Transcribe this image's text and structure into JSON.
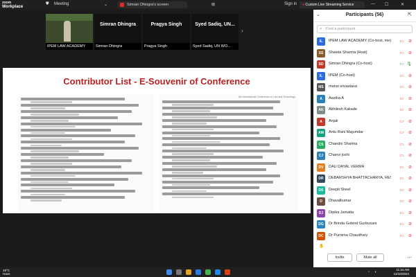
{
  "app": {
    "logo_line1": "zoom",
    "logo_line2": "Workplace",
    "meeting_label": "Meeting",
    "screen_tab_label": "Simran Dhingra's screen",
    "sign_in": "Sign in",
    "streaming_label": "Custom Live Streaming Service"
  },
  "video_tiles": [
    {
      "name": "IPEM LAW ACADEMY",
      "big_name": ""
    },
    {
      "name": "Simran Dhingra",
      "big_name": "Simran Dhingra"
    },
    {
      "name": "Pragya Singh",
      "big_name": "Pragya Singh"
    },
    {
      "name": "Syed Sadiq, UN WO...",
      "big_name": "Syed Sadiq, UN..."
    }
  ],
  "slide": {
    "title": "Contributor List - E-Souvenir of Conference",
    "right_header": "6th International Conference on Law and Technology"
  },
  "participants": {
    "title": "Participants (56)",
    "search_placeholder": "Find a participant",
    "items": [
      {
        "initials": "IL",
        "name": "IPEM LAW ACADEMY (Co-host, me)",
        "color": "#2d6cdf",
        "status": "muted"
      },
      {
        "initials": "SS",
        "name": "Shweta Sharma (Host)",
        "color": "#8a5a2b",
        "status": "muted"
      },
      {
        "initials": "SD",
        "name": "Simran Dhingra (Co-host)",
        "color": "#c0392b",
        "status": "live"
      },
      {
        "initials": "IL",
        "name": "IPEM (Co-host)",
        "color": "#2d6cdf",
        "status": "muted"
      },
      {
        "initials": "MS",
        "name": "mansi srivastava",
        "color": "#555555",
        "status": "muted"
      },
      {
        "initials": "A",
        "name": "Aastha A",
        "color": "#2980b9",
        "status": "muted"
      },
      {
        "initials": "AK",
        "name": "Akhilesh Kakade",
        "color": "#7f8c8d",
        "status": "muted"
      },
      {
        "initials": "A",
        "name": "Anjali",
        "color": "#c0392b",
        "status": "muted"
      },
      {
        "initials": "AM",
        "name": "Antu Rani Majumdar",
        "color": "#16a085",
        "status": "muted"
      },
      {
        "initials": "CS",
        "name": "Chandni Sharma",
        "color": "#27ae60",
        "status": "muted"
      },
      {
        "initials": "CJ",
        "name": "Chanvi joshi",
        "color": "#2c7fb8",
        "status": "muted"
      },
      {
        "initials": "DV",
        "name": "DAU DAYAL VERMA",
        "color": "#e67e22",
        "status": "muted"
      },
      {
        "initials": "DR",
        "name": "DEBARSHYA BHATTACHARYA, RESEARCH...",
        "color": "#34495e",
        "status": "muted"
      },
      {
        "initials": "DS",
        "name": "Deepit Sheel",
        "color": "#1abc9c",
        "status": "muted"
      },
      {
        "initials": "D",
        "name": "Dhavalkumar",
        "color": "#6d4c41",
        "status": "muted"
      },
      {
        "initials": "DJ",
        "name": "Dipika Jamatia",
        "color": "#8e44ad",
        "status": "muted"
      },
      {
        "initials": "DG",
        "name": "Dr Brinda Gobind Gurbuxani",
        "color": "#2e86c1",
        "status": "muted"
      },
      {
        "initials": "DC",
        "name": "Dr Purnima Chaudhary",
        "color": "#d35400",
        "status": "muted"
      }
    ],
    "invite_label": "Invite",
    "mute_all_label": "Mute all"
  },
  "taskbar": {
    "temp": "19°C",
    "weather": "Haze",
    "time": "11:34 AM",
    "date": "12/10/2024"
  }
}
